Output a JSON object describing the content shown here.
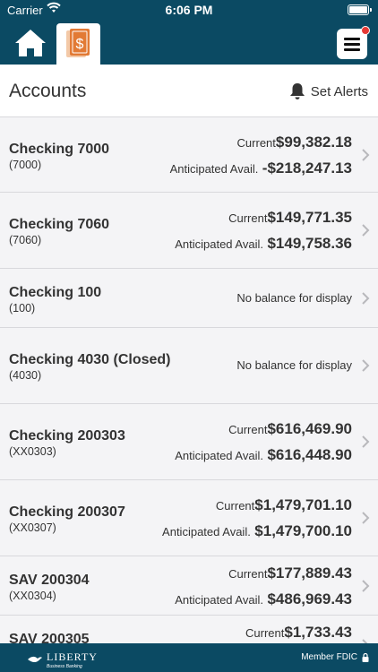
{
  "status_bar": {
    "carrier": "Carrier",
    "time": "6:06 PM"
  },
  "header": {
    "home_icon": "home-icon",
    "accounts_icon": "dollar-document-icon",
    "menu_icon": "hamburger-menu-icon",
    "notification_dot_color": "#e53935",
    "brand_color": "#0b4a63"
  },
  "page": {
    "title": "Accounts",
    "set_alerts_label": "Set Alerts",
    "no_balance_text": "No balance for display"
  },
  "labels": {
    "current": "Current",
    "anticipated": "Anticipated Avail."
  },
  "accounts": [
    {
      "name": "Checking 7000",
      "number": "(7000)",
      "current": "$99,382.18",
      "anticipated": "-$218,247.13"
    },
    {
      "name": "Checking 7060",
      "number": "(7060)",
      "current": "$149,771.35",
      "anticipated": "$149,758.36"
    },
    {
      "name": "Checking 100",
      "number": "(100)",
      "no_balance": "No balance for display"
    },
    {
      "name": "Checking 4030 (Closed)",
      "number": "(4030)",
      "no_balance": "No balance for display"
    },
    {
      "name": "Checking 200303",
      "number": "(XX0303)",
      "current": "$616,469.90",
      "anticipated": "$616,448.90"
    },
    {
      "name": "Checking 200307",
      "number": "(XX0307)",
      "current": "$1,479,701.10",
      "anticipated": "$1,479,700.10"
    },
    {
      "name": "SAV 200304",
      "number": "(XX0304)",
      "current": "$177,889.43",
      "anticipated": "$486,969.43"
    },
    {
      "name": "SAV 200305",
      "number": "",
      "current": "$1,733.43",
      "anticipated": ""
    }
  ],
  "footer": {
    "brand": "LIBERTY",
    "brand_sub": "Business Banking",
    "member_fdic": "Member FDIC"
  }
}
